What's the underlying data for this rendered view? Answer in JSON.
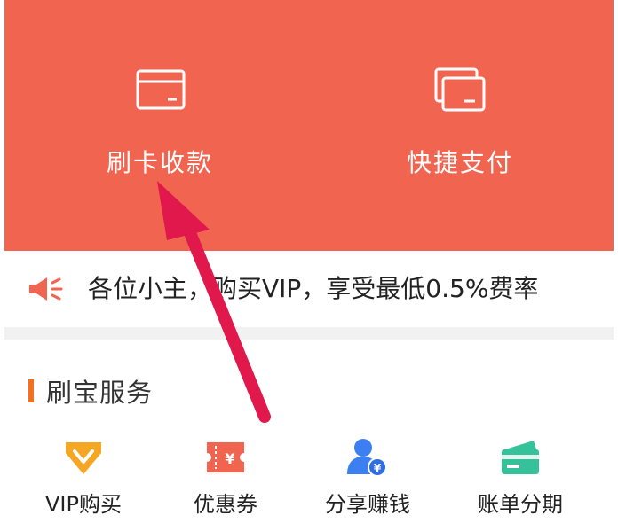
{
  "top_actions": {
    "swipe_card": {
      "label": "刷卡收款",
      "icon": "credit-card-icon"
    },
    "quick_pay": {
      "label": "快捷支付",
      "icon": "stacked-cards-icon"
    },
    "background": "#f06450"
  },
  "notice": {
    "icon": "speaker-icon",
    "text": "各位小主，购买VIP，享受最低0.5%费率"
  },
  "services": {
    "title": "刷宝服务",
    "items": [
      {
        "label": "VIP购买",
        "icon": "diamond-icon",
        "color": "#f5a623"
      },
      {
        "label": "优惠券",
        "icon": "coupon-icon",
        "color": "#f06450"
      },
      {
        "label": "分享赚钱",
        "icon": "user-money-icon",
        "color": "#3b7ff2"
      },
      {
        "label": "账单分期",
        "icon": "bill-card-icon",
        "color": "#35c29a"
      }
    ]
  },
  "annotation": {
    "icon": "pointer-arrow",
    "color": "#e0184c"
  }
}
